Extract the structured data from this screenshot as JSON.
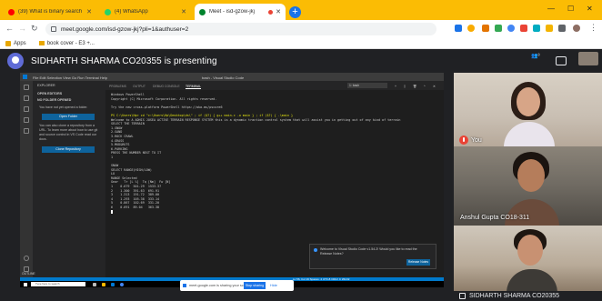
{
  "browser": {
    "tabs": [
      {
        "title": "(39) What is binary search - Yo...",
        "favicon_color": "#ff0000",
        "active": false
      },
      {
        "title": "(4) WhatsApp",
        "favicon_color": "#25d366",
        "active": false
      },
      {
        "title": "Meet - isd-gzow-jkj",
        "favicon_color": "#00832d",
        "active": true
      }
    ],
    "tabstrip_color": "#fbbc04",
    "url": "meet.google.com/isd-gzow-jkj?pli=1&authuser=2",
    "bookmarks": [
      {
        "label": "Apps"
      },
      {
        "label": "book cover - E3 +..."
      }
    ]
  },
  "meet": {
    "presenting_text": "SIDHARTH SHARMA CO20355 is presenting",
    "participants": [
      {
        "name": "You",
        "muted": true
      },
      {
        "name": "Anshul Gupta CO18-311",
        "muted": false
      },
      {
        "name": "SIDHARTH SHARMA CO20355",
        "muted": false
      }
    ],
    "share_bar": {
      "status": "meet.google.com is sharing your screen.",
      "stop_label": "Stop sharing",
      "hide_label": "Hide"
    }
  },
  "vscode": {
    "window_title": "bash - Visual Studio Code",
    "menu": "File   Edit   Selection   View   Go   Run   Terminal   Help",
    "sidebar": {
      "header": "EXPLORER",
      "open_editors": "OPEN EDITORS",
      "no_folder": "NO FOLDER OPENED",
      "no_folder_text": "You have not yet opened a folder.",
      "open_folder_button": "Open Folder",
      "clone_text": "You can also clone a repository from a URL. To learn more about how to use git and source control in VS Code read our docs.",
      "clone_button": "Clone Repository",
      "outline": "OUTLINE"
    },
    "panel_tabs": [
      "PROBLEMS",
      "OUTPUT",
      "DEBUG CONSOLE",
      "TERMINAL"
    ],
    "shell_select": "1: bash",
    "terminal_lines": [
      "Windows PowerShell",
      "Copyright (C) Microsoft Corporation. All rights reserved.",
      "",
      "Try the new cross-platform PowerShell https://aka.ms/pscore6",
      "",
      "PS C:\\Users\\Hp> cd \"c:\\Users\\Hp\\Desktop\\ds\\\" ; if ($?) { g++ main.c -o main } ; if ($?) { .\\main }",
      "Welcome to A ADHIS JOSEA ACTIVE TERRAIN RESPONSE SYSTEM this is a dynamic traction control system that will assist you in getting out of any kind of terrain",
      "SELECT THE TERRAIN",
      "1.SNOW",
      "2.SAND",
      "3.ROCK CRAWL",
      "4.GRASS",
      "5.MUD&RUTS",
      "6.PARKING",
      "PRESS THE NUMBER NEXT TO IT",
      "1",
      "",
      "SNOW",
      "SELECT RANGE(HIGH/LOW)",
      "LO",
      "RANGE Selected",
      "Gear   Tr [L %]  Tq [Nm]  Fw [N]",
      "1    0.679  501.29  1533.37",
      "2    1.300  391.63  691.91",
      "3    1.313  191.72  389.00",
      "4    1.293  105.38  333.14",
      "5    0.867  102.69  331.20",
      "6    0.691  89.04   363.38"
    ],
    "status_right": "Ln 56, Col 19   Spaces: 4   UTF-8   CRLF   C   Win32",
    "notification": {
      "message": "Welcome to Visual Studio Code v1.54.2! Would you like to read the Release Notes?",
      "button": "Release Notes"
    },
    "taskbar_search": "Type here to search"
  }
}
